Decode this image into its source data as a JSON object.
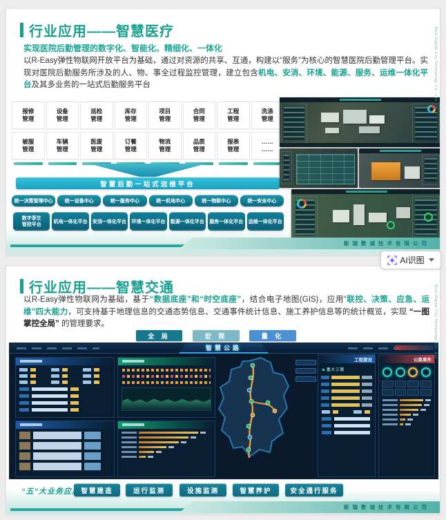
{
  "colors": {
    "brand_teal": "#17a08e",
    "accent_text": "#1aa193",
    "platform_bar_cyan": "#25b3cb",
    "button_dark_teal": "#0e7186",
    "btn_global": "#15788c",
    "btn_macro": "#7db9c6",
    "btn_quant": "#4a90d2",
    "dashboard_bg": "#0a1a2c",
    "events_header_red": "#c04040",
    "engineering_header_blue": "#1d5caa",
    "highlight_yellow": "#e4c25a",
    "ai_icon_purple": "#7b5cf0"
  },
  "ai_button": {
    "label": "AI识图"
  },
  "slide1": {
    "title": "行业应用——智慧医疗",
    "subtitle": "实现医院后勤管理的数字化、智能化、精细化、一体化",
    "paragraph": [
      {
        "text": "以R-Easy弹性物联网开放平台为基础，通过对资源的共享、互通，构建以“服务”为核心的智慧医院后勤管理平台。实现对医院后勤服务所涉及的人、物、事全过程监控管理，建立包含"
      },
      {
        "text": "机电、安消、环境、能源、服务、运维一体化平台"
      },
      {
        "text": "及其多业务的一站式后勤服务平台"
      }
    ],
    "modules": [
      "报修\n管理",
      "设备\n管理",
      "巡检\n管理",
      "库存\n管理",
      "项目\n管理",
      "合同\n管理",
      "工程\n管理",
      "洗涤\n管理",
      "被服\n管理",
      "车辆\n管理",
      "医废\n管理",
      "订餐\n管理",
      "物流\n管理",
      "品质\n管理",
      "报表\n管理",
      "……\n……"
    ],
    "platform_bar": "智慧后勤一站式运维平台",
    "centers": [
      "统一决策管理中心",
      "统一设备中心",
      "统一服务中心",
      "统一机电中心",
      "统一物联中心",
      "统一安全中心"
    ],
    "platforms": [
      "数字孪生\n管控平台",
      "机电一体化平台",
      "安消一体化平台",
      "环境一体化平台",
      "能源一体化平台",
      "服务一体化平台",
      "运维一体化平台"
    ],
    "footer_company": "新瑞数城技术有限公司",
    "side_watermark": "Best Digital City Technology Co., Ltd"
  },
  "slide2": {
    "title": "行业应用——智慧交通",
    "paragraph": [
      {
        "text": "以R-Easy弹性物联网为基础，基于"
      },
      {
        "text": "“数据底座”和“时空底座”"
      },
      {
        "text": "，结合电子地图(GIS)，应用“"
      },
      {
        "text": "联控、决策、应急、运维”四大能力"
      },
      {
        "text": "，可支持基于地理信息的交通态势信息、交通事件统计信息、施工养护信息等的统计概览，实现 "
      },
      {
        "text": "“一图掌控全局”"
      },
      {
        "text": " 的管理要求。"
      }
    ],
    "view_buttons": [
      "全 局",
      "宏 观",
      "量 化"
    ],
    "dashboard": {
      "title": "智慧公路",
      "panel_engineering": "工程建设",
      "panel_engineering_sub": "重大工程",
      "panel_events": "公路事件"
    },
    "biz_label": "“五”大业务应用",
    "biz_buttons": [
      "智慧建造",
      "运行监测",
      "设施监测",
      "智慧养护",
      "安全通行服务"
    ],
    "footer_company": "新瑞数城技术有限公司",
    "side_watermark": "Best Digital City Technology Co., Ltd"
  }
}
